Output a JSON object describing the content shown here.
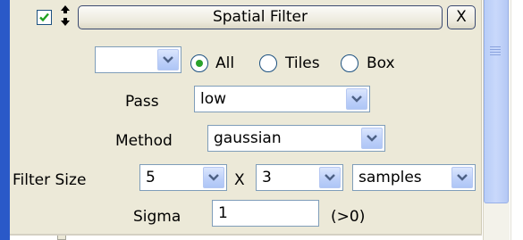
{
  "header": {
    "title": "Spatial Filter",
    "close_label": "X",
    "enabled": true
  },
  "region": {
    "selected_value": "",
    "options": [
      {
        "label": "All",
        "selected": true
      },
      {
        "label": "Tiles",
        "selected": false
      },
      {
        "label": "Box",
        "selected": false
      }
    ]
  },
  "pass": {
    "label": "Pass",
    "value": "low"
  },
  "method": {
    "label": "Method",
    "value": "gaussian"
  },
  "filter_size": {
    "label": "Filter Size",
    "x_value": "5",
    "separator": "X",
    "y_value": "3",
    "unit": "samples"
  },
  "sigma": {
    "label": "Sigma",
    "value": "1",
    "hint": "(>0)"
  },
  "colors": {
    "panel": "#ece9d8",
    "accent_blue": "#2a59c8",
    "radio_selected": "#2aa22a",
    "checkbox_check": "#21a121"
  },
  "icons": {
    "checkbox": "checkmark-icon",
    "reorder": "sort-arrows-icon",
    "dropdown": "chevron-down-icon"
  }
}
